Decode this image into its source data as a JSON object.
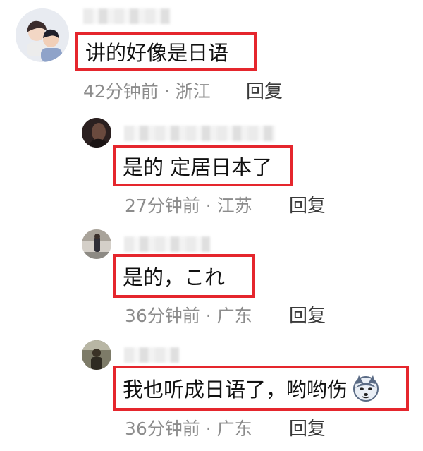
{
  "comments": [
    {
      "text": "讲的好像是日语",
      "meta": "42分钟前 · 浙江",
      "reply": "回复"
    },
    {
      "text": "是的 定居日本了",
      "meta": "27分钟前 · 江苏",
      "reply": "回复"
    },
    {
      "text": "是的，これ",
      "meta": "36分钟前 · 广东",
      "reply": "回复"
    },
    {
      "text": "我也听成日语了，哟哟伤",
      "meta": "36分钟前 · 广东",
      "reply": "回复",
      "emoji": "husky-face-emoji"
    }
  ],
  "colors": {
    "highlight_border": "#e5262d",
    "meta_text": "#8c8c8c"
  }
}
